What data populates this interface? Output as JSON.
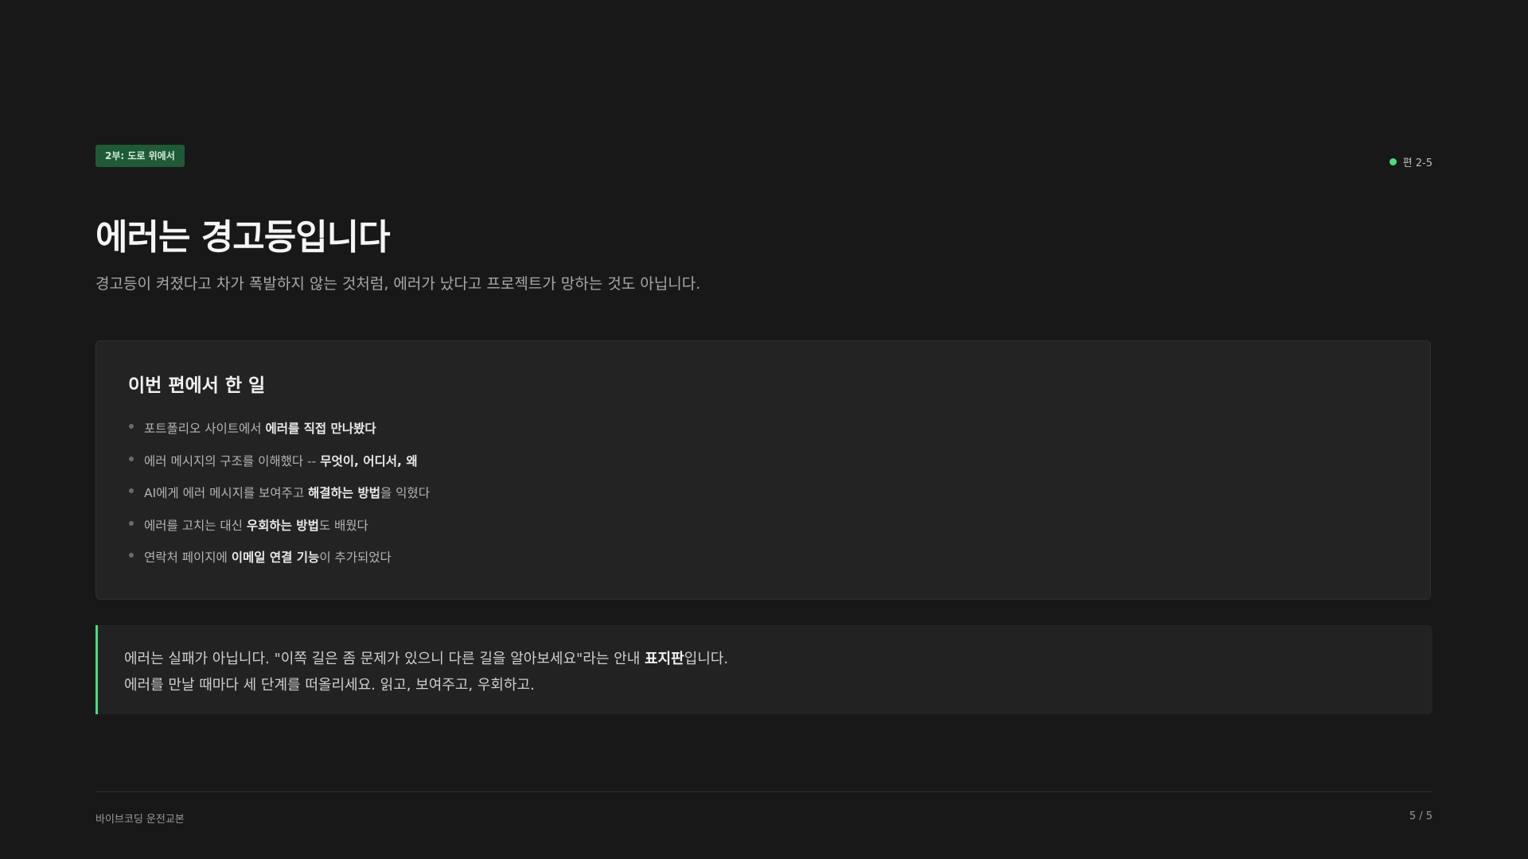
{
  "header": {
    "part_badge": "2부: 도로 위에서",
    "episode_label": "편 2-5"
  },
  "main": {
    "title": "에러는 경고등입니다",
    "subtitle": "경고등이 켜졌다고 차가 폭발하지 않는 것처럼, 에러가 났다고 프로젝트가 망하는 것도 아닙니다."
  },
  "summary": {
    "heading": "이번 편에서 한 일",
    "items": [
      {
        "before": "포트폴리오 사이트에서 ",
        "bold": "에러를 직접 만나봤다",
        "after": ""
      },
      {
        "before": "에러 메시지의 구조를 이해했다 -- ",
        "bold": "무엇이, 어디서, 왜",
        "after": ""
      },
      {
        "before": "AI에게 에러 메시지를 보여주고 ",
        "bold": "해결하는 방법",
        "after": "을 익혔다"
      },
      {
        "before": "에러를 고치는 대신 ",
        "bold": "우회하는 방법",
        "after": "도 배웠다"
      },
      {
        "before": "연락처 페이지에 ",
        "bold": "이메일 연결 기능",
        "after": "이 추가되었다"
      }
    ]
  },
  "callout": {
    "line1_before": "에러는 실패가 아닙니다. \"이쪽 길은 좀 문제가 있으니 다른 길을 알아보세요\"라는 안내 ",
    "line1_bold": "표지판",
    "line1_after": "입니다.",
    "line2": "에러를 만날 때마다 세 단계를 떠올리세요. 읽고, 보여주고, 우회하고."
  },
  "footer": {
    "book_title": "바이브코딩 운전교본",
    "page_indicator": "5 / 5"
  },
  "colors": {
    "background": "#181818",
    "accent": "#4ade80",
    "badge_bg": "#1f5a36",
    "card_bg": "#232323"
  }
}
